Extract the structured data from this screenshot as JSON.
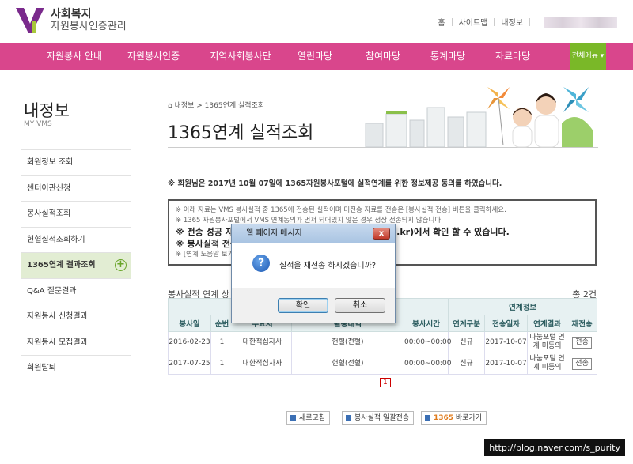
{
  "brand": {
    "line1": "사회복지",
    "line2": "자원봉사인증관리"
  },
  "util": {
    "home": "홈",
    "sitemap": "사이트맵",
    "myinfo": "내정보"
  },
  "nav": {
    "items": [
      "자원봉사 안내",
      "자원봉사인증",
      "지역사회봉사단",
      "열린마당",
      "참여마당",
      "통계마당",
      "자료마당"
    ],
    "all_menu": "전체메뉴 ▾"
  },
  "sidebar": {
    "title": "내정보",
    "subtitle": "MY VMS",
    "items": [
      "회원정보 조회",
      "센터이관신청",
      "봉사실적조회",
      "헌혈실적조회하기",
      "1365연계 결과조회",
      "Q&A 질문결과",
      "자원봉사 신청결과",
      "자원봉사 모집결과",
      "회원탈퇴"
    ],
    "active_index": 4
  },
  "content": {
    "breadcrumb": "⌂ 내정보 > 1365연계 실적조회",
    "title": "1365연계 실적조회",
    "notice": "※ 회원님은 2017년 10월 07일에 1365자원봉사포털에 실적연계를 위한 정보제공 동의를 하였습니다.",
    "info_lines": [
      "※ 아래 자료는 VMS 봉사실적 중 1365에 전송된 실적이며 미전송 자료를 전송은 [봉사실적 전송] 버튼을 클릭하세요.",
      "※ 1365 자원봉사포털에서 VMS 연계동의가 먼저 되어있지 않은 경우 정상 전송되지 않습니다."
    ],
    "info_big_1": "※ 전송 성공 자료",
    "info_big_1_tail": "365.go.kr)에서 확인 할 수 있습니다.",
    "info_big_2": "※ 봉사실적 전송",
    "info_line_3": "※ [연계 도움말 보기",
    "list_title": "봉사실적 연계 상",
    "count": "총 2건",
    "table": {
      "group_header": "연계정보",
      "headers": [
        "봉사일",
        "순번",
        "수요처",
        "활동내역",
        "봉사시간",
        "연계구분",
        "전송일자",
        "연계결과",
        "재전송"
      ],
      "rows": [
        [
          "2016-02-23",
          "1",
          "대한적십자사",
          "헌혈(전혈)",
          "00:00~00:00",
          "신규",
          "2017-10-07",
          "나눔포털 연계 미등의",
          "전송"
        ],
        [
          "2017-07-25",
          "1",
          "대한적십자사",
          "헌혈(전혈)",
          "00:00~00:00",
          "신규",
          "2017-10-07",
          "나눔포털 연계 미등의",
          "전송"
        ]
      ]
    },
    "pager": {
      "current": "1"
    },
    "buttons": {
      "refresh": "새로고침",
      "bulk_send": "봉사실적 일괄전송",
      "go_1365_prefix": "1365",
      "go_1365": " 바로가기"
    }
  },
  "dialog": {
    "title": "웹 페이지 메시지",
    "message": "실적을 재전송 하시겠습니까?",
    "ok": "확인",
    "cancel": "취소",
    "close": "x"
  },
  "watermark": "http://blog.naver.com/s_purity",
  "colors": {
    "nav": "#d9468c",
    "accent_green": "#7ab828",
    "logo_purple": "#7a2a8c"
  }
}
